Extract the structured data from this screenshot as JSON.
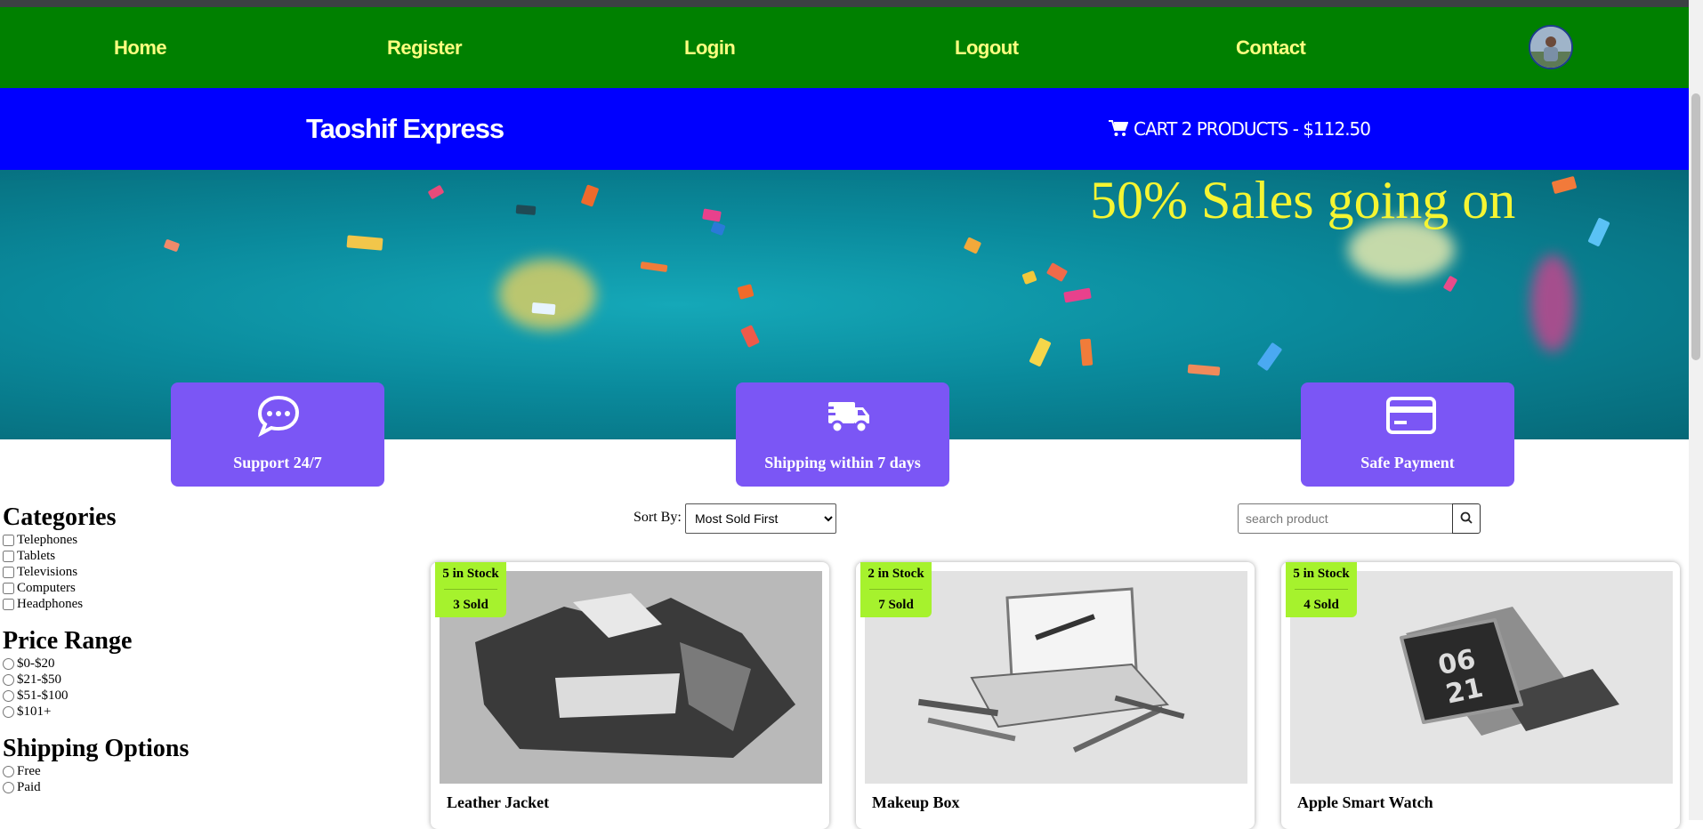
{
  "nav": {
    "links": [
      "Home",
      "Register",
      "Login",
      "Logout",
      "Contact"
    ]
  },
  "brand": {
    "name": "Taoshif Express",
    "cart_text": "CART 2 PRODUCTS - $112.50"
  },
  "hero": {
    "headline": "50% Sales going on"
  },
  "features": [
    {
      "label": "Support 24/7",
      "icon": "chat-icon"
    },
    {
      "label": "Shipping within 7 days",
      "icon": "truck-icon"
    },
    {
      "label": "Safe Payment",
      "icon": "credit-card-icon"
    }
  ],
  "sidebar": {
    "categories_title": "Categories",
    "categories": [
      "Telephones",
      "Tablets",
      "Televisions",
      "Computers",
      "Headphones"
    ],
    "price_title": "Price Range",
    "prices": [
      "$0-$20",
      "$21-$50",
      "$51-$100",
      "$101+"
    ],
    "shipping_title": "Shipping Options",
    "shipping": [
      "Free",
      "Paid"
    ]
  },
  "toolbar": {
    "sort_label": "Sort By:",
    "sort_value": "Most Sold First",
    "search_placeholder": "search product"
  },
  "products": [
    {
      "name": "Leather Jacket",
      "stock": "5 in Stock",
      "sold": "3 Sold"
    },
    {
      "name": "Makeup Box",
      "stock": "2 in Stock",
      "sold": "7 Sold"
    },
    {
      "name": "Apple Smart Watch",
      "stock": "5 in Stock",
      "sold": "4 Sold"
    }
  ],
  "colors": {
    "nav_bg": "#008000",
    "nav_text": "#ffff80",
    "brand_bg": "#0000ff",
    "feature_bg": "#7b56f5",
    "hero_text": "#f5f532",
    "badge_bg": "#a6f22d"
  }
}
